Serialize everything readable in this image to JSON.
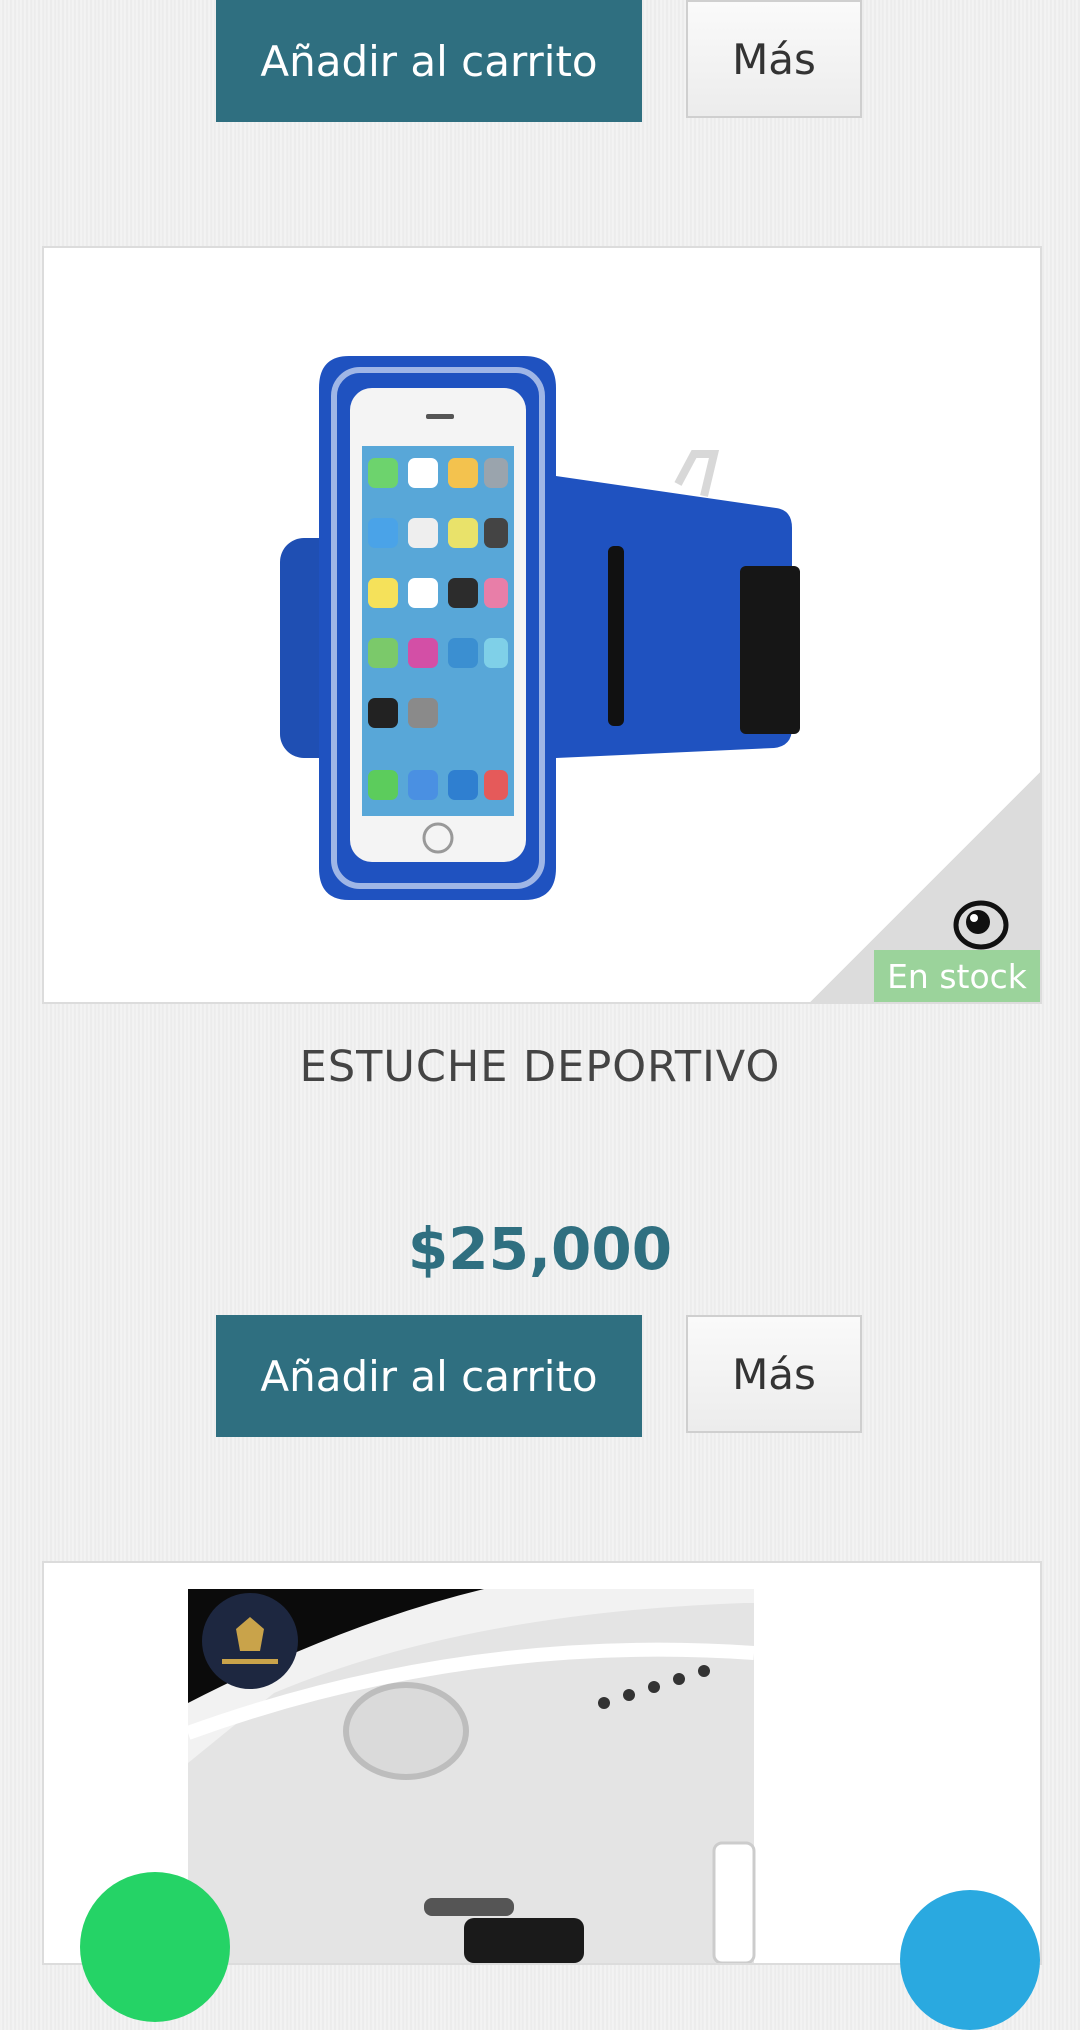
{
  "top_actions": {
    "add_to_cart_label": "Añadir al carrito",
    "more_label": "Más"
  },
  "product": {
    "name": "ESTUCHE DEPORTIVO",
    "price": "$25,000",
    "stock_label": "En stock",
    "add_to_cart_label": "Añadir al carrito",
    "more_label": "Más",
    "quick_view_icon": "eye-icon"
  },
  "next_product": {
    "logo_icon": "store-logo-icon"
  },
  "floating_buttons": {
    "left_icon": "whatsapp-icon",
    "right_icon": "chat-icon"
  },
  "colors": {
    "accent": "#2f6f80",
    "stock_badge": "#9bd39b",
    "whatsapp": "#25d366"
  }
}
